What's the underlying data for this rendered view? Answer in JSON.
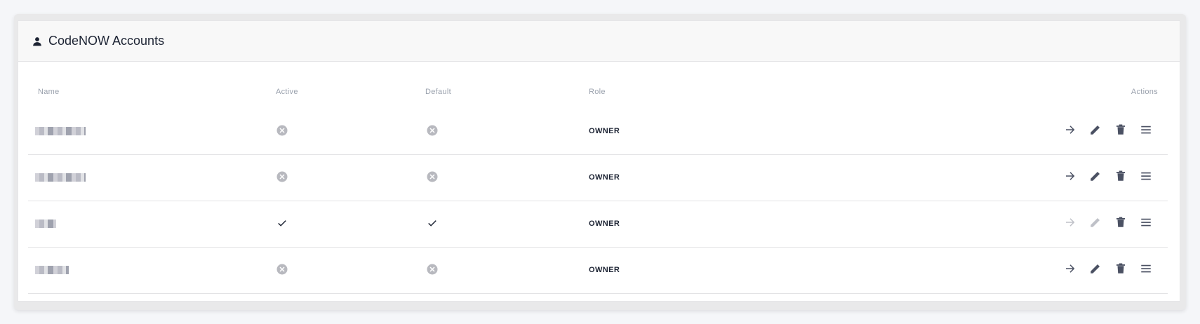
{
  "panel": {
    "title": "CodeNOW Accounts",
    "icon": "user-icon"
  },
  "table": {
    "headers": {
      "name": "Name",
      "active": "Active",
      "default": "Default",
      "role": "Role",
      "actions": "Actions"
    },
    "rows": [
      {
        "name": "",
        "active": false,
        "default": false,
        "role": "OWNER",
        "actions_enabled": true
      },
      {
        "name": "",
        "active": false,
        "default": false,
        "role": "OWNER",
        "actions_enabled": true
      },
      {
        "name": "",
        "active": true,
        "default": true,
        "role": "OWNER",
        "actions_enabled": false
      },
      {
        "name": "",
        "active": false,
        "default": false,
        "role": "OWNER",
        "actions_enabled": true
      }
    ]
  },
  "icons": {
    "inactive": "cancel-circle-icon",
    "active": "checkmark-icon",
    "actions": [
      "arrow-right-icon",
      "pencil-icon",
      "trash-icon",
      "menu-icon"
    ]
  },
  "colors": {
    "title": "#1c2333",
    "header_text": "#9aa1ad",
    "icon": "#4b5163",
    "status_gray": "#b8b9bf"
  }
}
